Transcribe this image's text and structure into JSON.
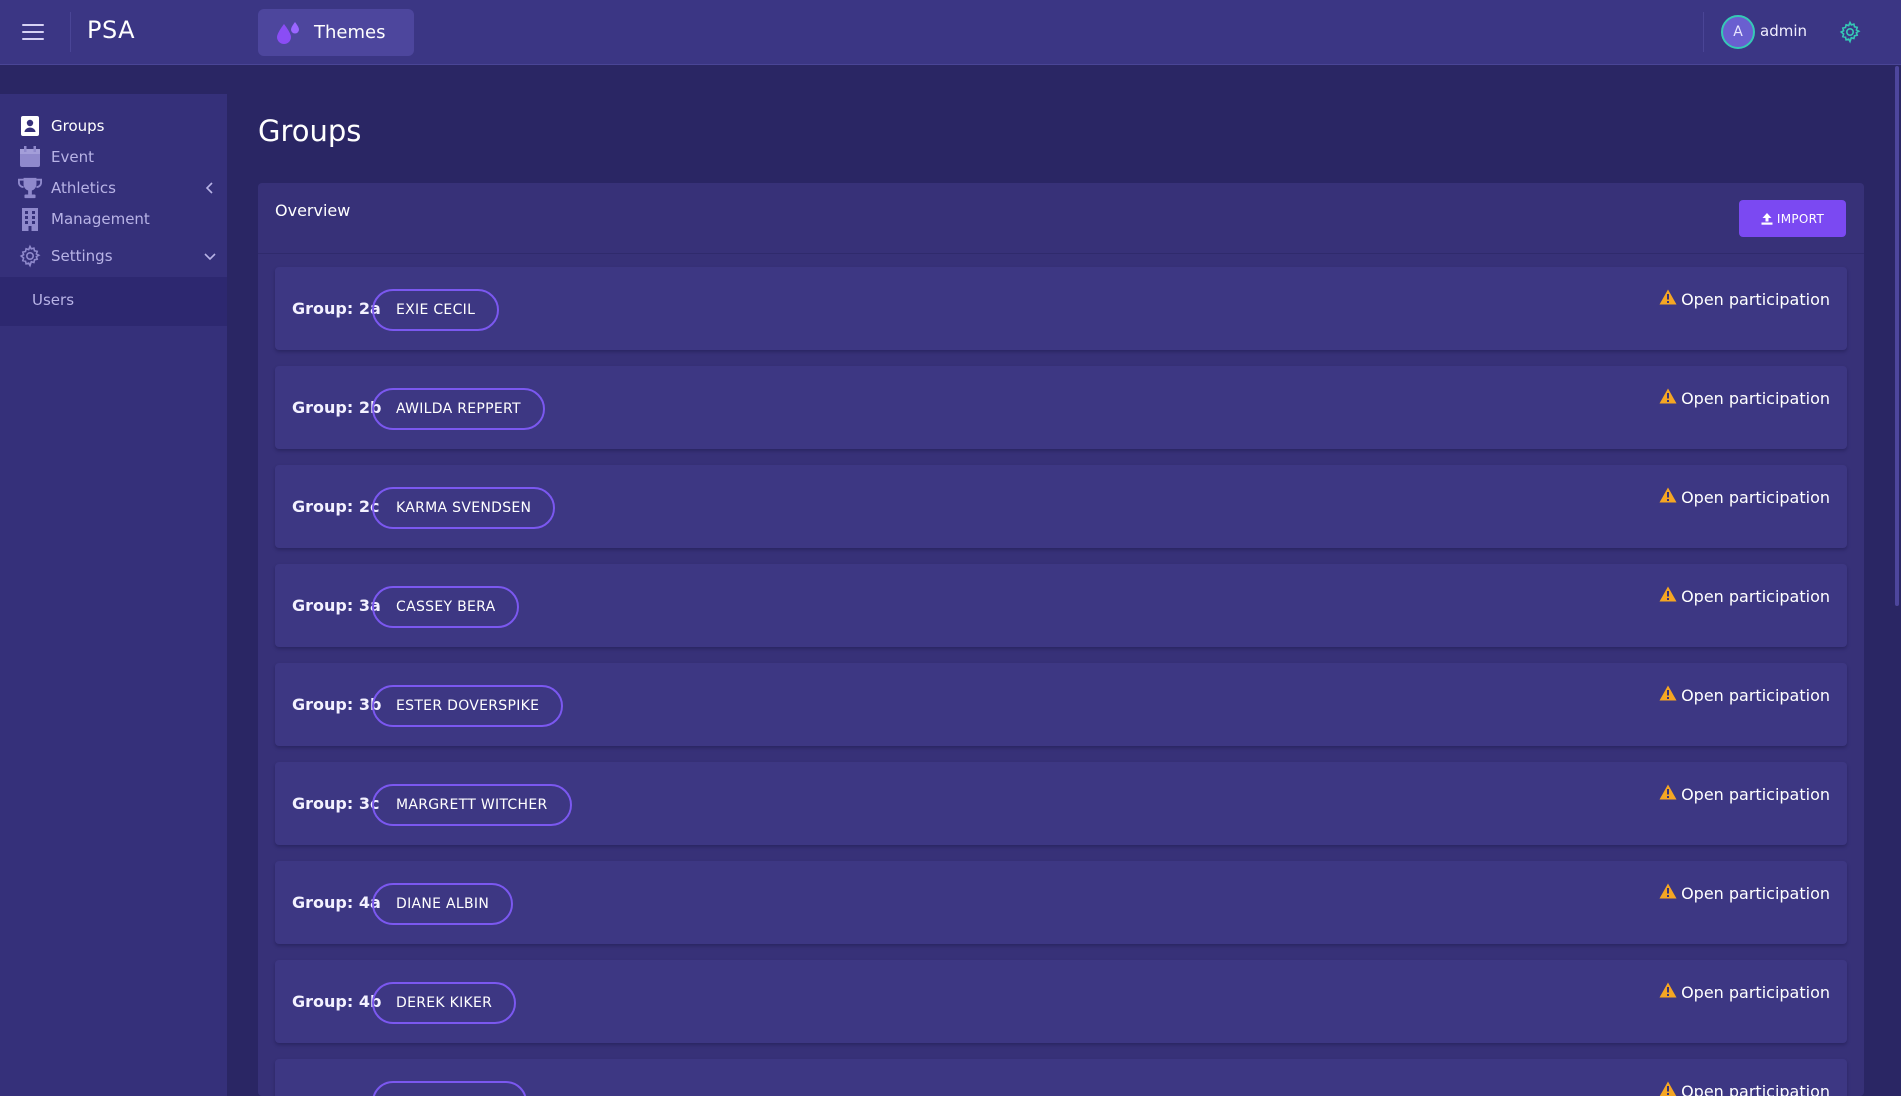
{
  "header": {
    "brand": "PSA",
    "themes_label": "Themes",
    "user_initial": "A",
    "user_name": "admin"
  },
  "sidebar": {
    "items": [
      {
        "label": "Groups",
        "icon": "contact-card-icon",
        "active": true
      },
      {
        "label": "Event",
        "icon": "calendar-icon"
      },
      {
        "label": "Athletics",
        "icon": "trophy-icon",
        "chevron": "chevron-left-icon"
      },
      {
        "label": "Management",
        "icon": "building-icon"
      },
      {
        "label": "Settings",
        "icon": "gear-icon",
        "chevron": "chevron-down-icon"
      }
    ],
    "submenu": [
      {
        "label": "Users"
      }
    ]
  },
  "page": {
    "title": "Groups"
  },
  "card": {
    "title": "Overview",
    "import_label": "IMPORT"
  },
  "groups": [
    {
      "label": "Group: 2a",
      "person": "EXIE CECIL",
      "status": "Open participation"
    },
    {
      "label": "Group: 2b",
      "person": "AWILDA REPPERT",
      "status": "Open participation"
    },
    {
      "label": "Group: 2c",
      "person": "KARMA SVENDSEN",
      "status": "Open participation"
    },
    {
      "label": "Group: 3a",
      "person": "CASSEY BERA",
      "status": "Open participation"
    },
    {
      "label": "Group: 3b",
      "person": "ESTER DOVERSPIKE",
      "status": "Open participation"
    },
    {
      "label": "Group: 3c",
      "person": "MARGRETT WITCHER",
      "status": "Open participation"
    },
    {
      "label": "Group: 4a",
      "person": "DIANE ALBIN",
      "status": "Open participation"
    },
    {
      "label": "Group: 4b",
      "person": "DEREK KIKER",
      "status": "Open participation"
    },
    {
      "label": "",
      "person": "",
      "status": "Open participation"
    }
  ],
  "colors": {
    "background": "#2a2664",
    "header": "#3b3684",
    "sidebar": "#35307a",
    "card": "#373178",
    "row": "#3d3783",
    "accent": "#7b49f2",
    "chip_border": "#7b58f0",
    "warning": "#f5a623",
    "avatar_ring": "#35c9b6"
  }
}
